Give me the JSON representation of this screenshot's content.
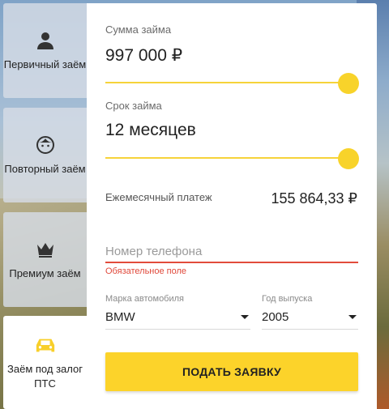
{
  "tabs": [
    {
      "label": "Первичный заём",
      "icon": "person-icon"
    },
    {
      "label": "Повторный заём",
      "icon": "face-icon"
    },
    {
      "label": "Премиум заём",
      "icon": "crown-icon"
    },
    {
      "label": "Заём под залог ПТС",
      "icon": "car-icon"
    }
  ],
  "active_tab": 3,
  "loan": {
    "amount_label": "Сумма займа",
    "amount_value": "997 000 ₽",
    "amount_slider_fraction": 1.0,
    "term_label": "Срок займа",
    "term_value": "12 месяцев",
    "term_slider_fraction": 1.0,
    "monthly_label": "Ежемесячный платеж",
    "monthly_value": "155 864,33 ₽"
  },
  "phone": {
    "placeholder": "Номер телефона",
    "value": "",
    "error": "Обязательное поле"
  },
  "car": {
    "brand_label": "Марка автомобиля",
    "brand_value": "BMW",
    "year_label": "Год выпуска",
    "year_value": "2005"
  },
  "submit_label": "ПОДАТЬ ЗАЯВКУ",
  "colors": {
    "accent": "#fcd32a",
    "error": "#e24c3b"
  }
}
